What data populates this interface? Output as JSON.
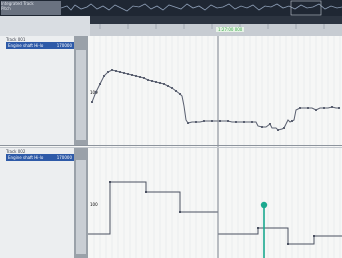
{
  "overview": {
    "label": "Integrated Track",
    "label_sub": "Pitch"
  },
  "ruler": {
    "time_readout": "1:27:00 000",
    "ticks": [
      "",
      "",
      "",
      "",
      "",
      "",
      ""
    ]
  },
  "tracks": [
    {
      "title_top": "Track 001",
      "name": "Engine shaft  Hi-lo",
      "value": "170000",
      "axis_label": "100"
    },
    {
      "title_top": "Track 002",
      "name": "Engine shaft  Hi-lo",
      "value": "170000",
      "axis_label": "100"
    }
  ],
  "colors": {
    "track_blue": "#2e5aa8",
    "curve": "#5a6070",
    "playhead": "#1aa98f",
    "overview_bg": "#1f2733"
  },
  "icons": {
    "playhead": "cursor-line-icon",
    "edit_point": "edit-point-icon"
  }
}
